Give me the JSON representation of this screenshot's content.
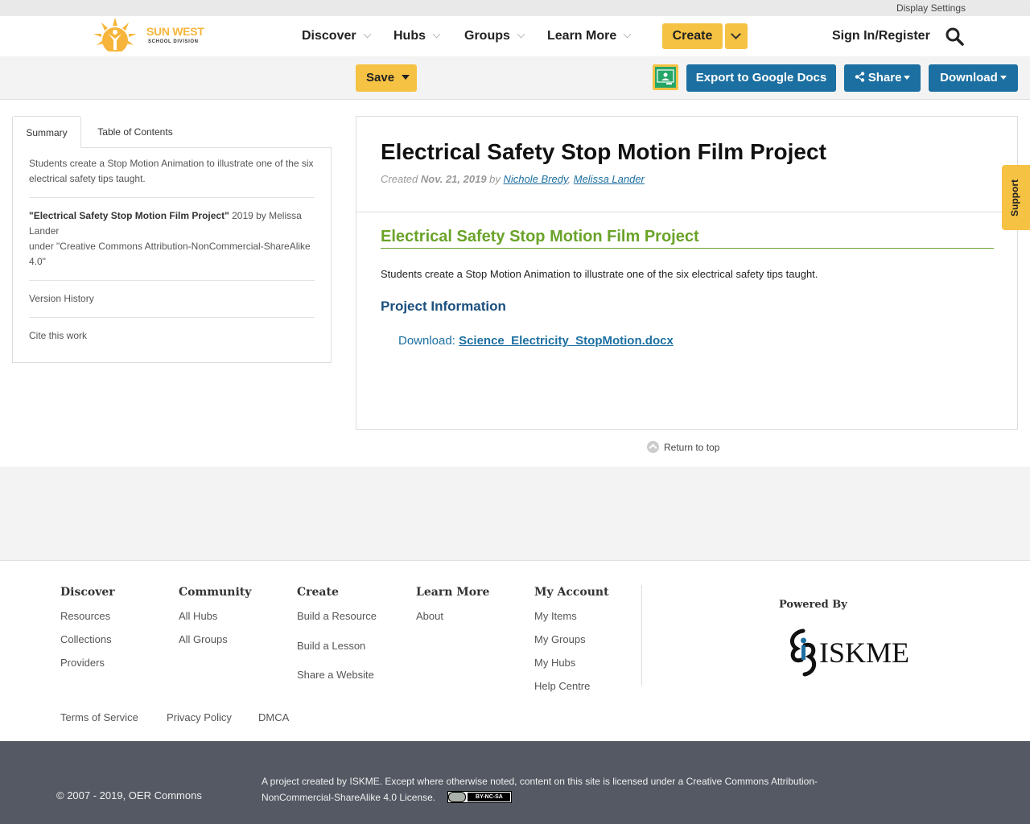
{
  "utility": {
    "display_settings": "Display Settings"
  },
  "header": {
    "logo_text_main": "SUN WEST",
    "logo_text_sub": "SCHOOL DIVISION",
    "nav": [
      "Discover",
      "Hubs",
      "Groups",
      "Learn More"
    ],
    "create": "Create",
    "signin": "Sign In/Register"
  },
  "toolbar": {
    "save": "Save",
    "export": "Export to Google Docs",
    "share": "Share",
    "download": "Download"
  },
  "sidebar": {
    "tabs": [
      "Summary",
      "Table of Contents"
    ],
    "summary": "Students create a Stop Motion Animation to illustrate one of the six electrical safety tips taught.",
    "citation_title": "\"Electrical Safety Stop Motion Film Project\"",
    "citation_rest": " 2019 by Melissa Lander",
    "citation_license": "under \"Creative Commons Attribution-NonCommercial-ShareAlike 4.0\"",
    "version_history": "Version History",
    "cite": "Cite this work"
  },
  "article": {
    "title": "Electrical Safety Stop Motion Film Project",
    "created_label": "Created",
    "date": "Nov. 21, 2019",
    "by": "by",
    "author1": "Nichole Bredy",
    "author2": "Melissa Lander",
    "section_title": "Electrical Safety Stop Motion Film Project",
    "description": "Students create a Stop Motion Animation to illustrate one of the six electrical safety tips taught.",
    "project_info": "Project Information",
    "download_label": "Download:",
    "download_file": "Science_Electricity_StopMotion.docx"
  },
  "return_top": "Return to top",
  "support": "Support",
  "footer": {
    "columns": [
      {
        "title": "Discover",
        "links": [
          "Resources",
          "Collections",
          "Providers"
        ]
      },
      {
        "title": "Community",
        "links": [
          "All Hubs",
          "All Groups"
        ]
      },
      {
        "title": "Create",
        "links": [
          "Build a Resource",
          "Build a Lesson",
          "Share a Website"
        ]
      },
      {
        "title": "Learn More",
        "links": [
          "About"
        ]
      },
      {
        "title": "My Account",
        "links": [
          "My Items",
          "My Groups",
          "My Hubs",
          "Help Centre"
        ]
      }
    ],
    "legal": [
      "Terms of Service",
      "Privacy Policy",
      "DMCA"
    ],
    "powered_by": "Powered By",
    "iskme": "ISKME"
  },
  "bottom": {
    "copyright": "© 2007 - 2019, OER Commons",
    "license": "A project created by ISKME. Except where otherwise noted, content on this site is licensed under a Creative Commons Attribution-NonCommercial-ShareAlike 4.0 License.",
    "cc_badge": "BY-NC-SA"
  },
  "colors": {
    "accent_yellow": "#f6c244",
    "button_blue": "#1c6fa1",
    "heading_green": "#6aa329",
    "heading_navy": "#1b4f7e",
    "footer_dark": "#545963"
  }
}
